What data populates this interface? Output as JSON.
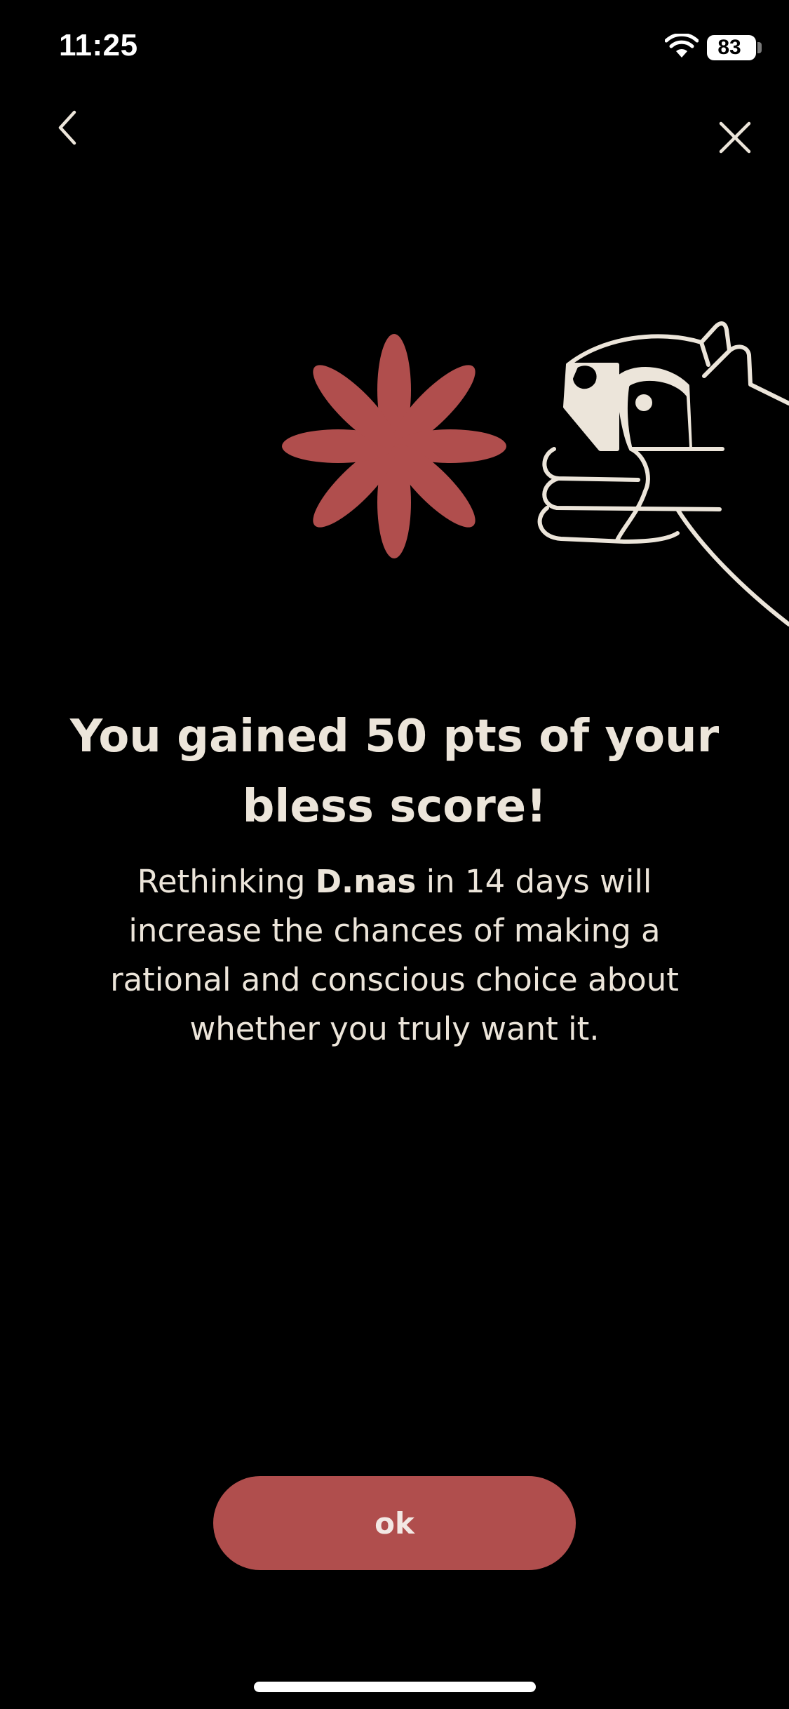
{
  "status_bar": {
    "time": "11:25",
    "battery": "83",
    "icons": [
      "wifi-icon",
      "battery-icon"
    ]
  },
  "nav": {
    "back_icon": "chevron-left-icon",
    "close_icon": "close-icon"
  },
  "illustration": {
    "icons": [
      "flower-icon",
      "raccoon-hand-icon"
    ],
    "colors": {
      "flower": "#B04E4D",
      "line": "#ECE5DA"
    }
  },
  "content": {
    "headline_line1": "You gained 50 pts of your",
    "headline_line2": "bless score!",
    "body_prefix": "Rethinking ",
    "body_item": "D.nas",
    "body_line1_suffix": " in 14 days will",
    "body_line2": "increase the chances of making a",
    "body_line3": "rational and conscious choice about",
    "body_line4": "whether you truly want it."
  },
  "actions": {
    "ok_label": "ok"
  },
  "colors": {
    "background": "#000000",
    "accent": "#B04E4D",
    "text": "#ECE5DA"
  }
}
